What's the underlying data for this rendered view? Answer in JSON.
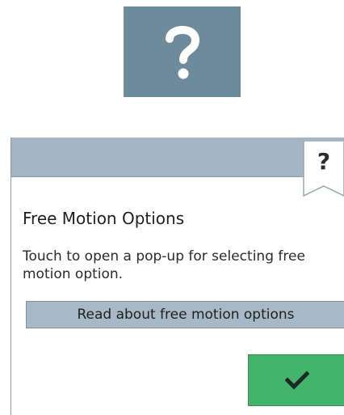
{
  "help_tile": {
    "icon": "question-mark-icon",
    "color": "#6e8a9d"
  },
  "popup": {
    "help_tab_symbol": "?",
    "title": "Free Motion Options",
    "description": "Touch to open a pop-up for selecting free motion option.",
    "read_button_label": "Read about free motion options",
    "ok_icon": "checkmark-icon",
    "colors": {
      "header": "#a4b5c5",
      "read_button": "#a7b8c7",
      "ok_button": "#43b46a"
    }
  }
}
